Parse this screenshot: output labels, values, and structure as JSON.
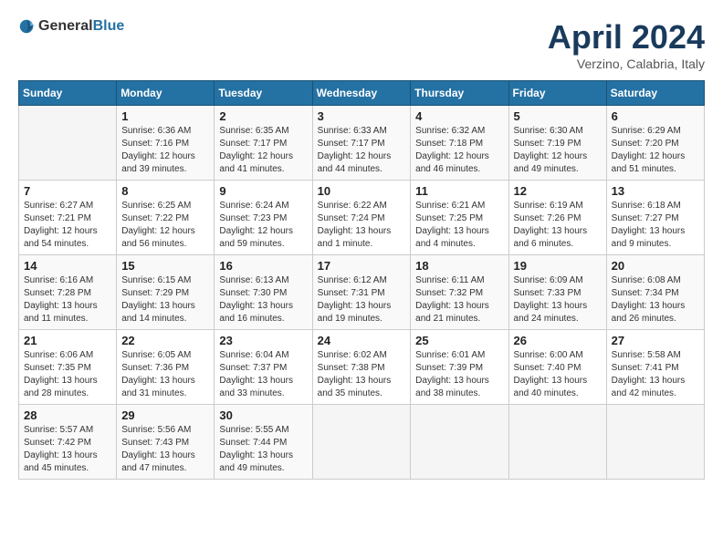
{
  "header": {
    "logo_general": "General",
    "logo_blue": "Blue",
    "month_title": "April 2024",
    "location": "Verzino, Calabria, Italy"
  },
  "columns": [
    "Sunday",
    "Monday",
    "Tuesday",
    "Wednesday",
    "Thursday",
    "Friday",
    "Saturday"
  ],
  "weeks": [
    [
      {
        "day": "",
        "sunrise": "",
        "sunset": "",
        "daylight": ""
      },
      {
        "day": "1",
        "sunrise": "Sunrise: 6:36 AM",
        "sunset": "Sunset: 7:16 PM",
        "daylight": "Daylight: 12 hours and 39 minutes."
      },
      {
        "day": "2",
        "sunrise": "Sunrise: 6:35 AM",
        "sunset": "Sunset: 7:17 PM",
        "daylight": "Daylight: 12 hours and 41 minutes."
      },
      {
        "day": "3",
        "sunrise": "Sunrise: 6:33 AM",
        "sunset": "Sunset: 7:17 PM",
        "daylight": "Daylight: 12 hours and 44 minutes."
      },
      {
        "day": "4",
        "sunrise": "Sunrise: 6:32 AM",
        "sunset": "Sunset: 7:18 PM",
        "daylight": "Daylight: 12 hours and 46 minutes."
      },
      {
        "day": "5",
        "sunrise": "Sunrise: 6:30 AM",
        "sunset": "Sunset: 7:19 PM",
        "daylight": "Daylight: 12 hours and 49 minutes."
      },
      {
        "day": "6",
        "sunrise": "Sunrise: 6:29 AM",
        "sunset": "Sunset: 7:20 PM",
        "daylight": "Daylight: 12 hours and 51 minutes."
      }
    ],
    [
      {
        "day": "7",
        "sunrise": "Sunrise: 6:27 AM",
        "sunset": "Sunset: 7:21 PM",
        "daylight": "Daylight: 12 hours and 54 minutes."
      },
      {
        "day": "8",
        "sunrise": "Sunrise: 6:25 AM",
        "sunset": "Sunset: 7:22 PM",
        "daylight": "Daylight: 12 hours and 56 minutes."
      },
      {
        "day": "9",
        "sunrise": "Sunrise: 6:24 AM",
        "sunset": "Sunset: 7:23 PM",
        "daylight": "Daylight: 12 hours and 59 minutes."
      },
      {
        "day": "10",
        "sunrise": "Sunrise: 6:22 AM",
        "sunset": "Sunset: 7:24 PM",
        "daylight": "Daylight: 13 hours and 1 minute."
      },
      {
        "day": "11",
        "sunrise": "Sunrise: 6:21 AM",
        "sunset": "Sunset: 7:25 PM",
        "daylight": "Daylight: 13 hours and 4 minutes."
      },
      {
        "day": "12",
        "sunrise": "Sunrise: 6:19 AM",
        "sunset": "Sunset: 7:26 PM",
        "daylight": "Daylight: 13 hours and 6 minutes."
      },
      {
        "day": "13",
        "sunrise": "Sunrise: 6:18 AM",
        "sunset": "Sunset: 7:27 PM",
        "daylight": "Daylight: 13 hours and 9 minutes."
      }
    ],
    [
      {
        "day": "14",
        "sunrise": "Sunrise: 6:16 AM",
        "sunset": "Sunset: 7:28 PM",
        "daylight": "Daylight: 13 hours and 11 minutes."
      },
      {
        "day": "15",
        "sunrise": "Sunrise: 6:15 AM",
        "sunset": "Sunset: 7:29 PM",
        "daylight": "Daylight: 13 hours and 14 minutes."
      },
      {
        "day": "16",
        "sunrise": "Sunrise: 6:13 AM",
        "sunset": "Sunset: 7:30 PM",
        "daylight": "Daylight: 13 hours and 16 minutes."
      },
      {
        "day": "17",
        "sunrise": "Sunrise: 6:12 AM",
        "sunset": "Sunset: 7:31 PM",
        "daylight": "Daylight: 13 hours and 19 minutes."
      },
      {
        "day": "18",
        "sunrise": "Sunrise: 6:11 AM",
        "sunset": "Sunset: 7:32 PM",
        "daylight": "Daylight: 13 hours and 21 minutes."
      },
      {
        "day": "19",
        "sunrise": "Sunrise: 6:09 AM",
        "sunset": "Sunset: 7:33 PM",
        "daylight": "Daylight: 13 hours and 24 minutes."
      },
      {
        "day": "20",
        "sunrise": "Sunrise: 6:08 AM",
        "sunset": "Sunset: 7:34 PM",
        "daylight": "Daylight: 13 hours and 26 minutes."
      }
    ],
    [
      {
        "day": "21",
        "sunrise": "Sunrise: 6:06 AM",
        "sunset": "Sunset: 7:35 PM",
        "daylight": "Daylight: 13 hours and 28 minutes."
      },
      {
        "day": "22",
        "sunrise": "Sunrise: 6:05 AM",
        "sunset": "Sunset: 7:36 PM",
        "daylight": "Daylight: 13 hours and 31 minutes."
      },
      {
        "day": "23",
        "sunrise": "Sunrise: 6:04 AM",
        "sunset": "Sunset: 7:37 PM",
        "daylight": "Daylight: 13 hours and 33 minutes."
      },
      {
        "day": "24",
        "sunrise": "Sunrise: 6:02 AM",
        "sunset": "Sunset: 7:38 PM",
        "daylight": "Daylight: 13 hours and 35 minutes."
      },
      {
        "day": "25",
        "sunrise": "Sunrise: 6:01 AM",
        "sunset": "Sunset: 7:39 PM",
        "daylight": "Daylight: 13 hours and 38 minutes."
      },
      {
        "day": "26",
        "sunrise": "Sunrise: 6:00 AM",
        "sunset": "Sunset: 7:40 PM",
        "daylight": "Daylight: 13 hours and 40 minutes."
      },
      {
        "day": "27",
        "sunrise": "Sunrise: 5:58 AM",
        "sunset": "Sunset: 7:41 PM",
        "daylight": "Daylight: 13 hours and 42 minutes."
      }
    ],
    [
      {
        "day": "28",
        "sunrise": "Sunrise: 5:57 AM",
        "sunset": "Sunset: 7:42 PM",
        "daylight": "Daylight: 13 hours and 45 minutes."
      },
      {
        "day": "29",
        "sunrise": "Sunrise: 5:56 AM",
        "sunset": "Sunset: 7:43 PM",
        "daylight": "Daylight: 13 hours and 47 minutes."
      },
      {
        "day": "30",
        "sunrise": "Sunrise: 5:55 AM",
        "sunset": "Sunset: 7:44 PM",
        "daylight": "Daylight: 13 hours and 49 minutes."
      },
      {
        "day": "",
        "sunrise": "",
        "sunset": "",
        "daylight": ""
      },
      {
        "day": "",
        "sunrise": "",
        "sunset": "",
        "daylight": ""
      },
      {
        "day": "",
        "sunrise": "",
        "sunset": "",
        "daylight": ""
      },
      {
        "day": "",
        "sunrise": "",
        "sunset": "",
        "daylight": ""
      }
    ]
  ]
}
